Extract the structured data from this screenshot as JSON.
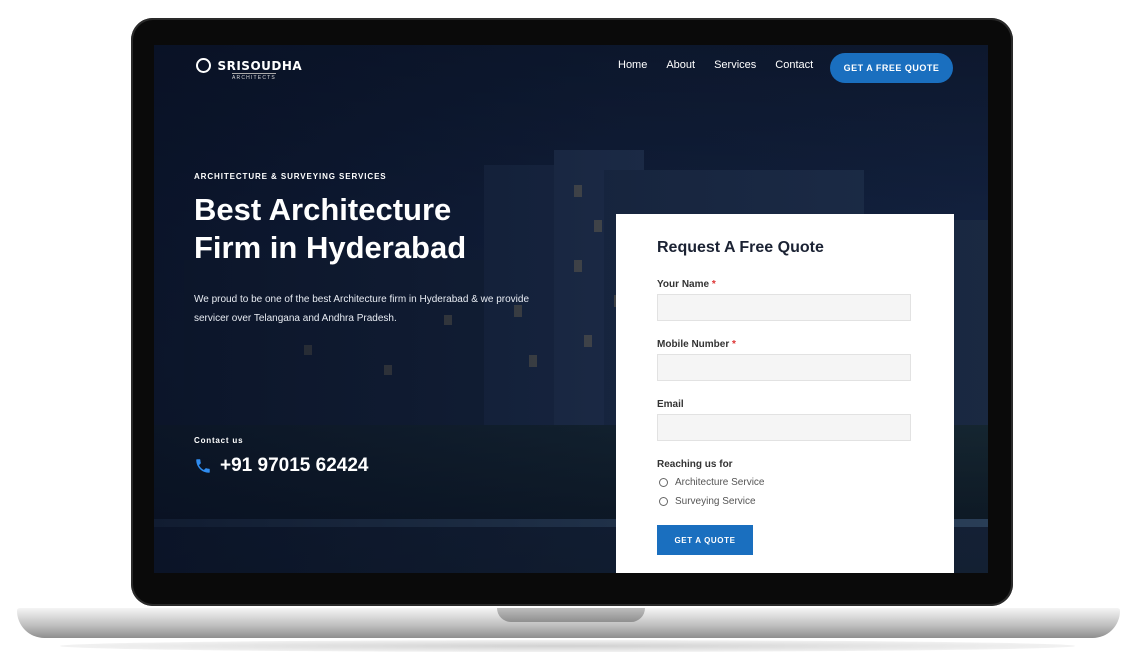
{
  "brand": {
    "name": "SRISOUDHA",
    "tagline": "ARCHITECTS"
  },
  "nav": {
    "items": [
      {
        "label": "Home"
      },
      {
        "label": "About"
      },
      {
        "label": "Services"
      },
      {
        "label": "Contact"
      }
    ]
  },
  "header_cta": {
    "label": "GET A FREE QUOTE"
  },
  "hero": {
    "eyebrow": "ARCHITECTURE & SURVEYING SERVICES",
    "title_line1": "Best Architecture",
    "title_line2": "Firm in Hyderabad",
    "description": "We proud to be one of the best Architecture firm in Hyderabad & we provide servicer over Telangana and Andhra Pradesh.",
    "contact_label": "Contact us",
    "phone": "+91 97015 62424"
  },
  "form": {
    "title": "Request A Free Quote",
    "name_label": "Your Name",
    "mobile_label": "Mobile Number",
    "email_label": "Email",
    "required_marker": "*",
    "reaching_label": "Reaching us for",
    "options": [
      {
        "label": "Architecture Service"
      },
      {
        "label": "Surveying Service"
      }
    ],
    "submit_label": "GET A QUOTE"
  },
  "colors": {
    "accent": "#1a6fbf",
    "hero_bg": "#13203a",
    "card_bg": "#ffffff"
  },
  "icons": [
    "phone-icon",
    "logo-mark-icon"
  ]
}
